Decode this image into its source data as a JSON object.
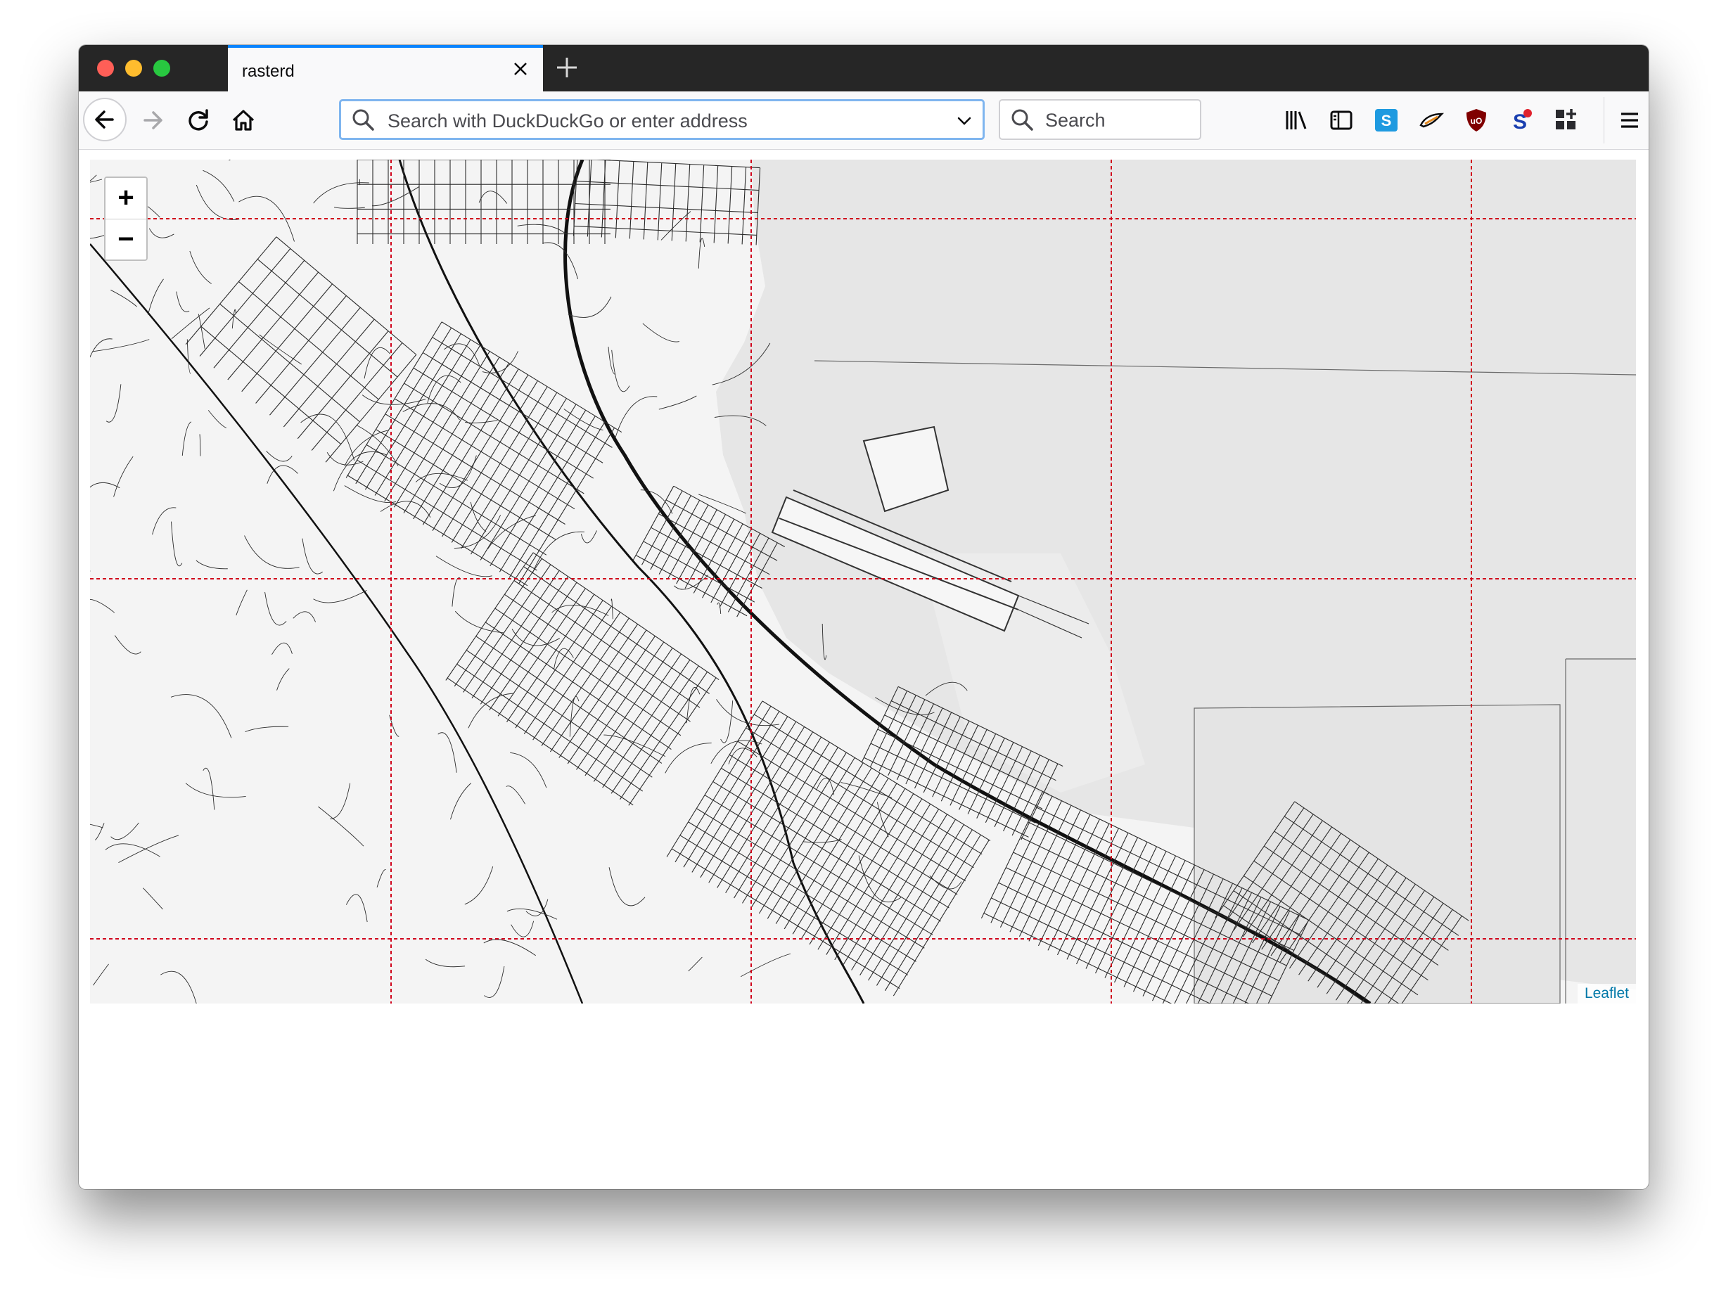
{
  "browser": {
    "tab": {
      "title": "rasterd"
    },
    "urlbar": {
      "placeholder": "Search with DuckDuckGo or enter address",
      "value": ""
    },
    "searchbar": {
      "placeholder": "Search"
    },
    "toolbar_icons": [
      "library-icon",
      "sidebar-icon",
      "skype-extension-icon",
      "extension-bird-icon",
      "ublock-origin-icon",
      "extension-s-icon",
      "extensions-grid-icon",
      "menu-icon"
    ]
  },
  "map": {
    "zoom_in_label": "+",
    "zoom_out_label": "−",
    "attribution": "Leaflet",
    "tile_grid_color": "#d0021b",
    "land_color": "#f3f3f3",
    "water_color": "#e6e6e6"
  }
}
